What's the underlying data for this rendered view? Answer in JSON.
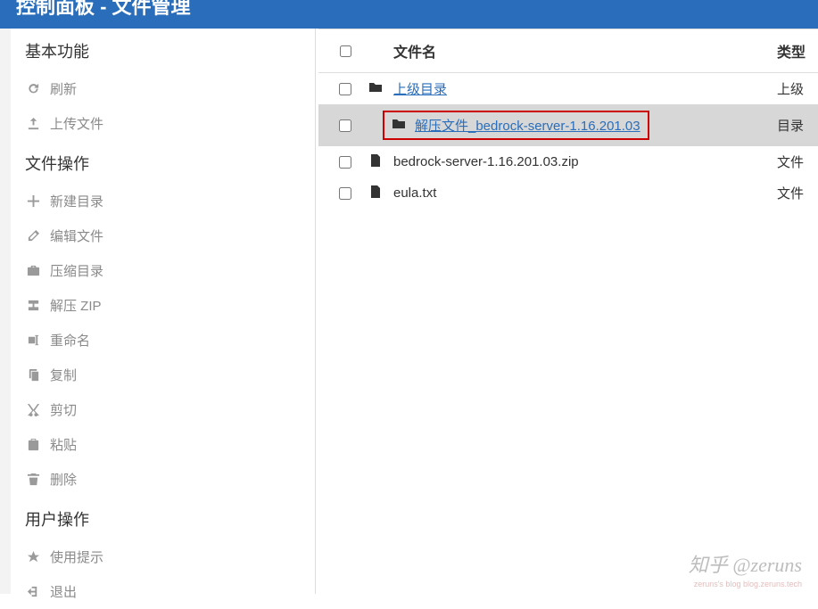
{
  "header": {
    "title": "控制面板 - 文件管理"
  },
  "sidebar": {
    "sections": [
      {
        "title": "基本功能",
        "items": [
          {
            "icon": "refresh",
            "label": "刷新"
          },
          {
            "icon": "upload",
            "label": "上传文件"
          }
        ]
      },
      {
        "title": "文件操作",
        "items": [
          {
            "icon": "plus",
            "label": "新建目录"
          },
          {
            "icon": "pencil",
            "label": "编辑文件"
          },
          {
            "icon": "briefcase",
            "label": "压缩目录"
          },
          {
            "icon": "unzip",
            "label": "解压 ZIP"
          },
          {
            "icon": "rename",
            "label": "重命名"
          },
          {
            "icon": "copy",
            "label": "复制"
          },
          {
            "icon": "cut",
            "label": "剪切"
          },
          {
            "icon": "paste",
            "label": "粘贴"
          },
          {
            "icon": "trash",
            "label": "删除"
          }
        ]
      },
      {
        "title": "用户操作",
        "items": [
          {
            "icon": "star",
            "label": "使用提示"
          },
          {
            "icon": "logout",
            "label": "退出"
          }
        ]
      }
    ]
  },
  "table": {
    "columns": {
      "name": "文件名",
      "type": "类型"
    },
    "rows": [
      {
        "icon": "folder",
        "name": "上级目录",
        "type": "上级",
        "link": true,
        "highlighted": false
      },
      {
        "icon": "folder",
        "name": "解压文件_bedrock-server-1.16.201.03",
        "type": "目录",
        "link": true,
        "highlighted": true
      },
      {
        "icon": "file",
        "name": "bedrock-server-1.16.201.03.zip",
        "type": "文件",
        "link": false,
        "highlighted": false
      },
      {
        "icon": "file",
        "name": "eula.txt",
        "type": "文件",
        "link": false,
        "highlighted": false
      }
    ]
  },
  "watermark": {
    "main": "知乎 @zeruns",
    "sub": "zeruns's blog  blog.zeruns.tech"
  }
}
